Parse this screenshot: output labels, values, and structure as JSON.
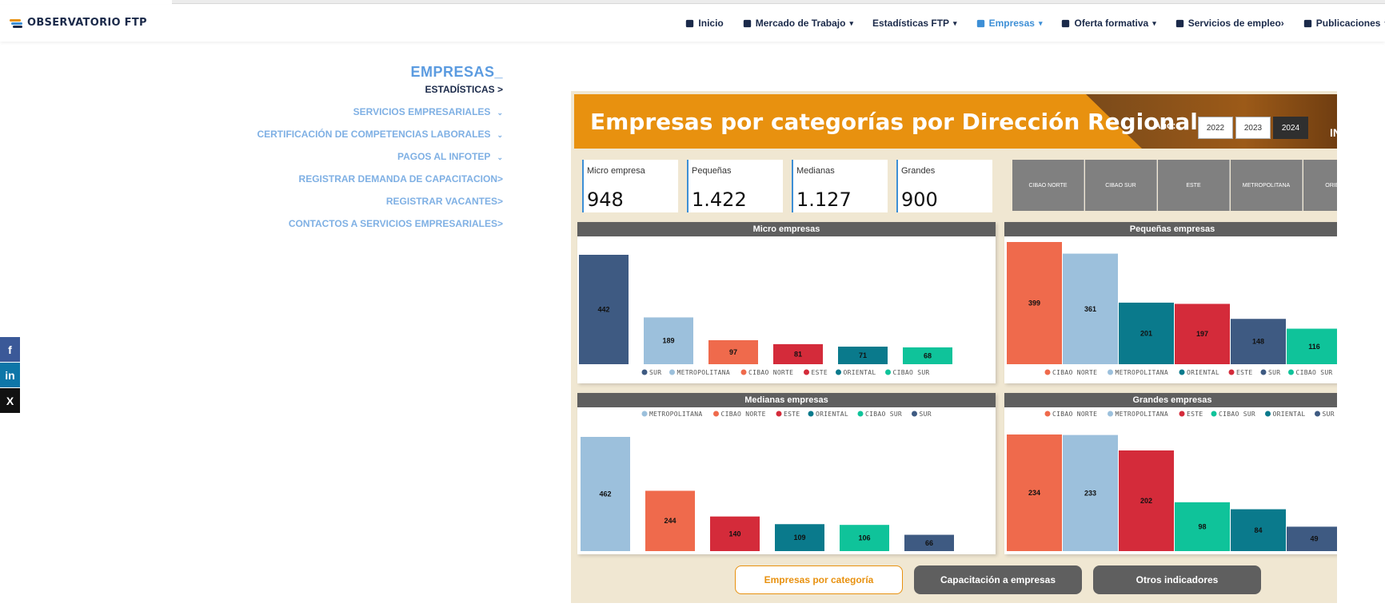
{
  "header": {
    "logo_text": "OBSERVATORIO FTP",
    "nav": [
      {
        "label": "Inicio",
        "icon": "home-icon",
        "chevron": false,
        "active": false
      },
      {
        "label": "Mercado de Trabajo",
        "icon": "table-icon",
        "chevron": true,
        "active": false
      },
      {
        "label": "Estadísticas FTP",
        "icon": "",
        "chevron": true,
        "active": false
      },
      {
        "label": "Empresas",
        "icon": "handshake-icon",
        "chevron": true,
        "active": true
      },
      {
        "label": "Oferta formativa",
        "icon": "graduation-cap-icon",
        "chevron": true,
        "active": false
      },
      {
        "label": "Servicios de empleo›",
        "icon": "id-card-icon",
        "chevron": false,
        "active": false
      },
      {
        "label": "Publicaciones",
        "icon": "book-icon",
        "chevron": true,
        "active": false
      }
    ]
  },
  "menu": {
    "title": "EMPRESAS_",
    "subtitle": "ESTADÍSTICAS >",
    "items": [
      {
        "label": "SERVICIOS EMPRESARIALES",
        "dropdown": true
      },
      {
        "label": "CERTIFICACIÓN DE COMPETENCIAS LABORALES",
        "dropdown": true
      },
      {
        "label": "PAGOS AL INFOTEP",
        "dropdown": true
      },
      {
        "label": "REGISTRAR DEMANDA DE CAPACITACION>",
        "dropdown": false
      },
      {
        "label": "REGISTRAR VACANTES>",
        "dropdown": false
      },
      {
        "label": "CONTACTOS A SERVICIOS EMPRESARIALES>",
        "dropdown": false
      }
    ]
  },
  "social": [
    {
      "label": "f",
      "icon": "facebook-icon",
      "color": "#3b5998"
    },
    {
      "label": "in",
      "icon": "linkedin-icon",
      "color": "#0e76a8"
    },
    {
      "label": "X",
      "icon": "x-icon",
      "color": "#111111"
    }
  ],
  "dashboard": {
    "title": "Empresas por categorías por Dirección Regional",
    "year_label": "Año:",
    "years": [
      "2022",
      "2023",
      "2024"
    ],
    "selected_year": "2024",
    "banner_extra": "IN",
    "kpis": [
      {
        "label": "Micro empresa",
        "value": "948"
      },
      {
        "label": "Pequeñas",
        "value": "1.422"
      },
      {
        "label": "Medianas",
        "value": "1.127"
      },
      {
        "label": "Grandes",
        "value": "900"
      }
    ],
    "regions": [
      "CIBAO NORTE",
      "CIBAO SUR",
      "ESTE",
      "METROPOLITANA",
      "ORIENTAL"
    ],
    "tabs": [
      {
        "label": "Empresas por categoría",
        "active": true
      },
      {
        "label": "Capacitación a empresas",
        "active": false
      },
      {
        "label": "Otros indicadores",
        "active": false
      }
    ]
  },
  "colors": {
    "SUR": "#3e5a82",
    "METROPOLITANA": "#9cc0dc",
    "CIBAO NORTE": "#ef6a4c",
    "ESTE": "#d42b3a",
    "ORIENTAL": "#0a7a8c",
    "CIBAO SUR": "#0fc39a"
  },
  "chart_data": [
    {
      "type": "bar",
      "title": "Micro empresas",
      "legend_position": "bottom",
      "categories": [
        "SUR",
        "METROPOLITANA",
        "CIBAO NORTE",
        "ESTE",
        "ORIENTAL",
        "CIBAO SUR"
      ],
      "values": [
        442,
        189,
        97,
        81,
        71,
        68
      ]
    },
    {
      "type": "bar",
      "title": "Pequeñas empresas",
      "legend_position": "bottom",
      "categories": [
        "CIBAO NORTE",
        "METROPOLITANA",
        "ORIENTAL",
        "ESTE",
        "SUR",
        "CIBAO SUR"
      ],
      "values": [
        399,
        361,
        201,
        197,
        148,
        116
      ]
    },
    {
      "type": "bar",
      "title": "Medianas empresas",
      "legend_position": "top",
      "categories": [
        "METROPOLITANA",
        "CIBAO NORTE",
        "ESTE",
        "ORIENTAL",
        "CIBAO SUR",
        "SUR"
      ],
      "values": [
        462,
        244,
        140,
        109,
        106,
        66
      ]
    },
    {
      "type": "bar",
      "title": "Grandes empresas",
      "legend_position": "top",
      "categories": [
        "CIBAO NORTE",
        "METROPOLITANA",
        "ESTE",
        "CIBAO SUR",
        "ORIENTAL",
        "SUR"
      ],
      "values": [
        234,
        233,
        202,
        98,
        84,
        49
      ]
    }
  ]
}
